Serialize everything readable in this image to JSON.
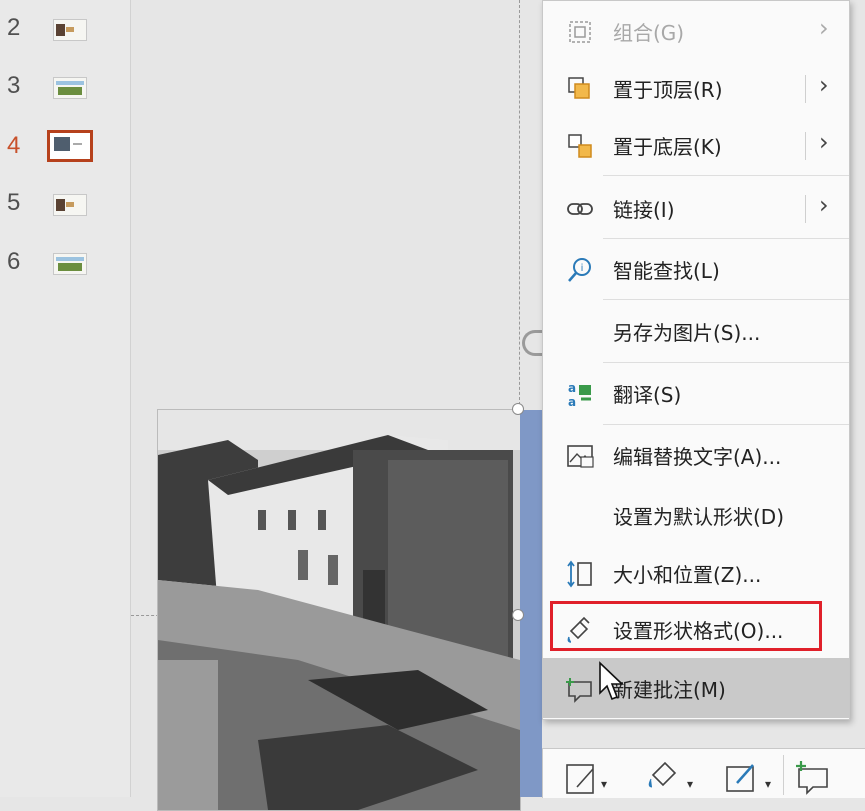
{
  "slides": [
    {
      "number": "2",
      "thumb": "a"
    },
    {
      "number": "3",
      "thumb": "b"
    },
    {
      "number": "4",
      "thumb": "c",
      "active": true
    },
    {
      "number": "5",
      "thumb": "a"
    },
    {
      "number": "6",
      "thumb": "b"
    }
  ],
  "context_menu": {
    "items": [
      {
        "label": "组合(G)",
        "icon": "group-icon",
        "submenu": true,
        "disabled": true
      },
      {
        "label": "置于顶层(R)",
        "icon": "bring-to-front-icon",
        "submenu": true
      },
      {
        "label": "置于底层(K)",
        "icon": "send-to-back-icon",
        "submenu": true
      },
      {
        "label": "链接(I)",
        "icon": "link-icon",
        "submenu": true
      },
      {
        "label": "智能查找(L)",
        "icon": "smart-lookup-icon"
      },
      {
        "label": "另存为图片(S)...",
        "icon": ""
      },
      {
        "label": "翻译(S)",
        "icon": "translate-icon"
      },
      {
        "label": "编辑替换文字(A)...",
        "icon": "alt-text-icon"
      },
      {
        "label": "设置为默认形状(D)",
        "icon": ""
      },
      {
        "label": "大小和位置(Z)...",
        "icon": "size-position-icon"
      },
      {
        "label": "设置形状格式(O)...",
        "icon": "format-shape-icon",
        "outlined": true
      },
      {
        "label": "新建批注(M)",
        "icon": "new-comment-icon",
        "hovered": true
      }
    ]
  },
  "mini_toolbar": {
    "buttons": [
      "style-icon",
      "fill-icon",
      "outline-icon",
      "new-comment-icon"
    ]
  },
  "colors": {
    "active_slide_border": "#b6411c",
    "highlight_box": "#e0202a",
    "selection_bar": "#7f98c6"
  }
}
